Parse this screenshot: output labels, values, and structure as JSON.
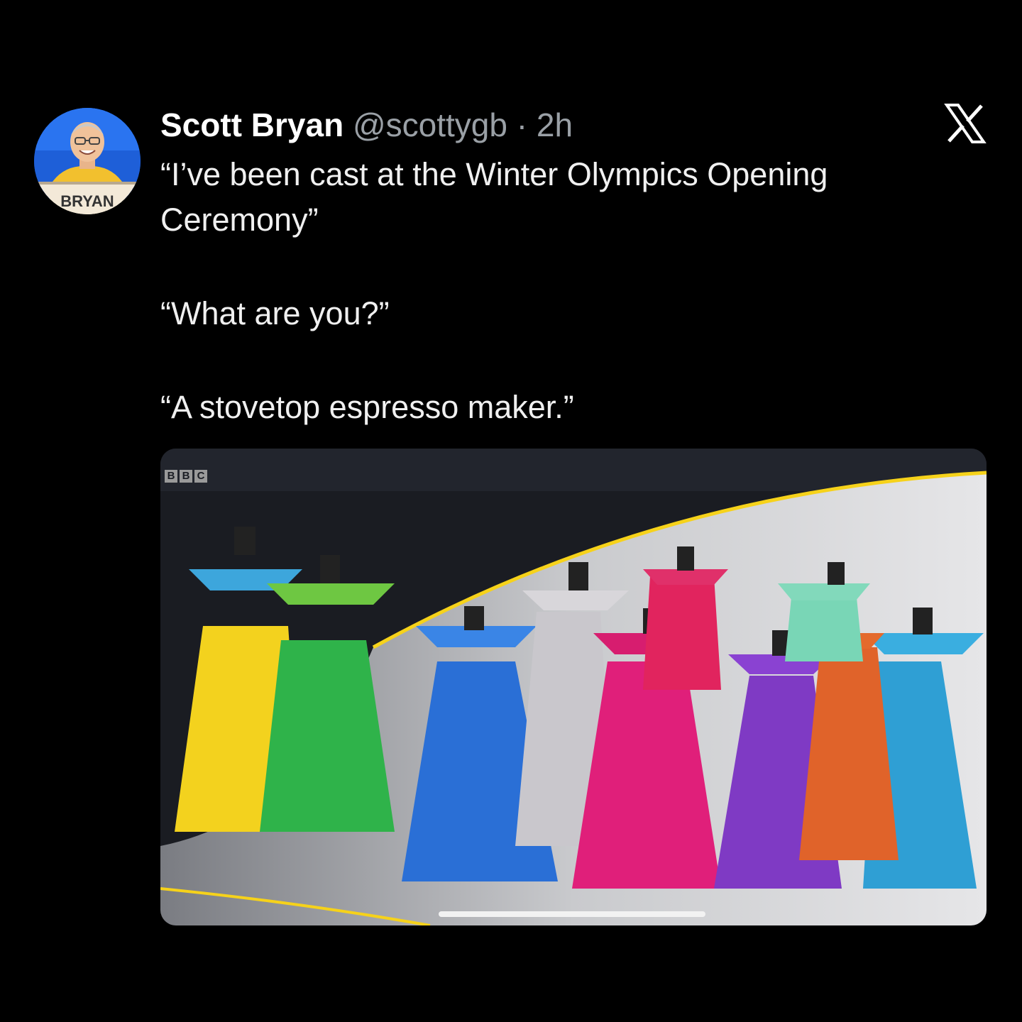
{
  "tweet": {
    "display_name": "Scott Bryan",
    "handle": "@scottygb",
    "separator": "·",
    "time": "2h",
    "avatar_label": "BRYAN",
    "paragraphs": [
      "“I’ve been cast at the Winter Olympics Opening Ceremony”",
      "“What are you?”",
      "“A stovetop espresso maker.”"
    ]
  },
  "media": {
    "watermark": [
      "B",
      "B",
      "C"
    ],
    "icon": "video-frame",
    "scrubber": "progress-bar"
  },
  "colors": {
    "background": "#000000",
    "text": "#f0f0f0",
    "secondary_text": "#9aa0a6"
  },
  "icons": {
    "platform": "x-logo-icon"
  }
}
